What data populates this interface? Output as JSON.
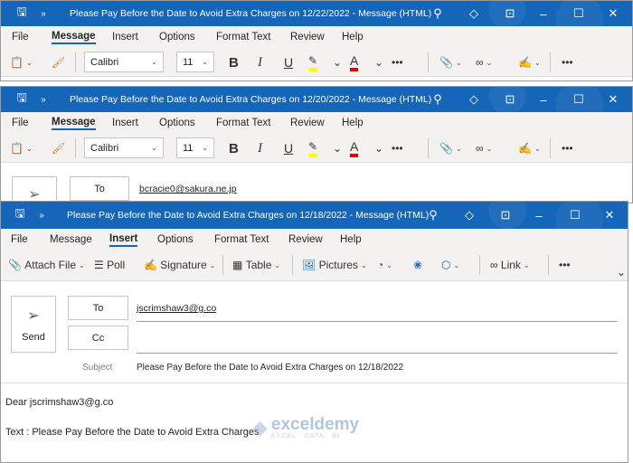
{
  "windows": [
    {
      "title": "Please Pay Before the Date to Avoid Extra Charges on 12/22/2022  -  Message (HTML)",
      "active_tab": "Message"
    },
    {
      "title": "Please Pay Before the Date to Avoid Extra Charges on 12/20/2022  -  Message (HTML)",
      "active_tab": "Message",
      "to": "bcracie0@sakura.ne.jp"
    },
    {
      "title": "Please Pay Before the Date to Avoid Extra Charges on 12/18/2022  -  Message (HTML)",
      "active_tab": "Insert"
    }
  ],
  "menu": {
    "file": "File",
    "message": "Message",
    "insert": "Insert",
    "options": "Options",
    "format_text": "Format Text",
    "review": "Review",
    "help": "Help"
  },
  "format_toolbar": {
    "font": "Calibri",
    "size": "11",
    "bold": "B",
    "italic": "I",
    "underline": "U",
    "font_color": "A",
    "more": "•••"
  },
  "insert_toolbar": {
    "attach": "Attach File",
    "poll": "Poll",
    "signature": "Signature",
    "table": "Table",
    "pictures": "Pictures",
    "link": "Link",
    "more": "•••"
  },
  "compose": {
    "send": "Send",
    "to_label": "To",
    "cc_label": "Cc",
    "to": "jscrimshaw3@g.co",
    "cc": "",
    "subject_label": "Subject",
    "subject": "Please Pay Before the Date to Avoid Extra Charges on 12/18/2022"
  },
  "body": {
    "greeting": "Dear jscrimshaw3@g.co",
    "text": "Text : Please Pay Before the Date to Avoid Extra Charges"
  },
  "watermark": {
    "name": "exceldemy",
    "tagline": "EXCEL · DATA · BI"
  },
  "colors": {
    "titlebar": "#1565b8",
    "highlight": "#ffff00",
    "font_color": "#e00000"
  }
}
